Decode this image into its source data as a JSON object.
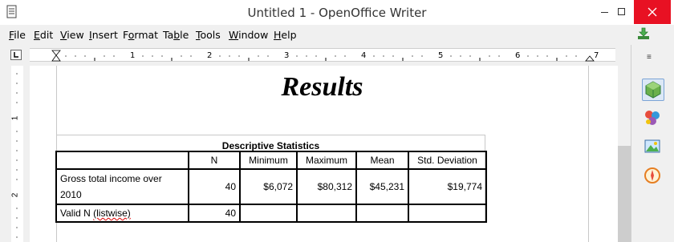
{
  "window": {
    "title": "Untitled 1 - OpenOffice Writer"
  },
  "menu": [
    {
      "label": "File",
      "u": "F",
      "rest": "ile"
    },
    {
      "label": "Edit",
      "u": "E",
      "rest": "dit"
    },
    {
      "label": "View",
      "u": "V",
      "rest": "iew"
    },
    {
      "label": "Insert",
      "u": "I",
      "rest": "nsert"
    },
    {
      "label": "Format",
      "u": "o",
      "pre": "F",
      "rest": "rmat"
    },
    {
      "label": "Table",
      "u": "b",
      "pre": "Ta",
      "rest": "le"
    },
    {
      "label": "Tools",
      "u": "T",
      "rest": "ools"
    },
    {
      "label": "Window",
      "u": "W",
      "rest": "indow"
    },
    {
      "label": "Help",
      "u": "H",
      "rest": "elp"
    }
  ],
  "ruler": {
    "numbers": [
      "1",
      "2",
      "3",
      "4",
      "5",
      "6",
      "7"
    ]
  },
  "vruler": {
    "numbers": [
      "1",
      "2"
    ]
  },
  "document": {
    "heading": "Results",
    "table": {
      "caption": "Descriptive Statistics",
      "headers": [
        "",
        "N",
        "Minimum",
        "Maximum",
        "Mean",
        "Std. Deviation"
      ],
      "rows": [
        {
          "label_line1": "Gross total income over",
          "label_line2": "2010",
          "n": "40",
          "min": "$6,072",
          "max": "$80,312",
          "mean": "$45,231",
          "sd": "$19,774"
        },
        {
          "label_prefix": "Valid N ",
          "label_spell": "(listwise)",
          "n": "40",
          "min": "",
          "max": "",
          "mean": "",
          "sd": ""
        }
      ]
    }
  },
  "icons": {
    "app": "writer-document-icon",
    "download": "update-download-icon",
    "sidebar": [
      "properties-icon",
      "styles-icon",
      "gallery-icon",
      "navigator-icon"
    ]
  }
}
